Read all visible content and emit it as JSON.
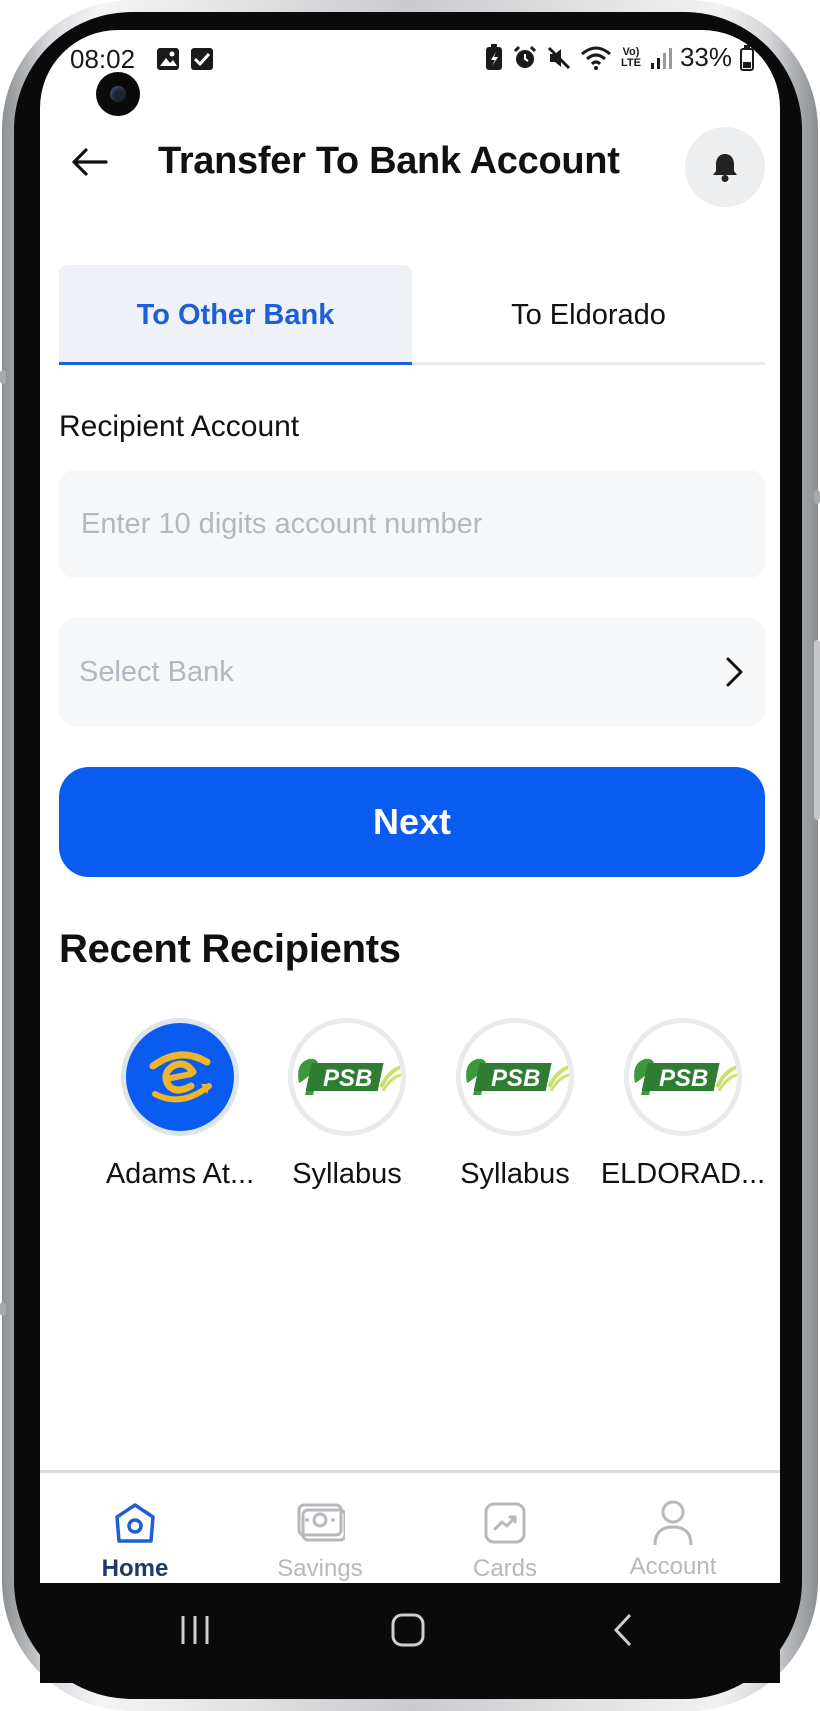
{
  "status_bar": {
    "time": "08:02",
    "battery": "33%",
    "network": "Vo) LTE"
  },
  "header": {
    "title": "Transfer To Bank Account",
    "back_icon": "arrow-left-icon",
    "bell_icon": "bell-icon"
  },
  "tabs": [
    {
      "label": "To Other Bank",
      "active": true
    },
    {
      "label": "To Eldorado",
      "active": false
    }
  ],
  "form": {
    "recipient_label": "Recipient Account",
    "account_value": "",
    "account_placeholder": "Enter 10 digits account number",
    "bank_placeholder": "Select Bank",
    "next_label": "Next"
  },
  "recent": {
    "title": "Recent Recipients",
    "items": [
      {
        "name": "Adams At...",
        "logo": "eldorado-logo"
      },
      {
        "name": "Syllabus",
        "logo": "9psb-logo",
        "logo_text": "PSB"
      },
      {
        "name": "Syllabus",
        "logo": "9psb-logo",
        "logo_text": "PSB"
      },
      {
        "name": "ELDORAD...",
        "logo": "9psb-logo",
        "logo_text": "PSB"
      }
    ]
  },
  "bottom_nav": [
    {
      "label": "Home",
      "icon": "home-icon",
      "active": true
    },
    {
      "label": "Savings",
      "icon": "savings-icon",
      "active": false
    },
    {
      "label": "Cards",
      "icon": "cards-icon",
      "active": false
    },
    {
      "label": "Account",
      "icon": "account-icon",
      "active": false
    }
  ],
  "colors": {
    "primary": "#0a5cf0",
    "tab_active": "#1d5fd8",
    "nav_active": "#1e3a6d",
    "placeholder": "#b4b6c2"
  }
}
